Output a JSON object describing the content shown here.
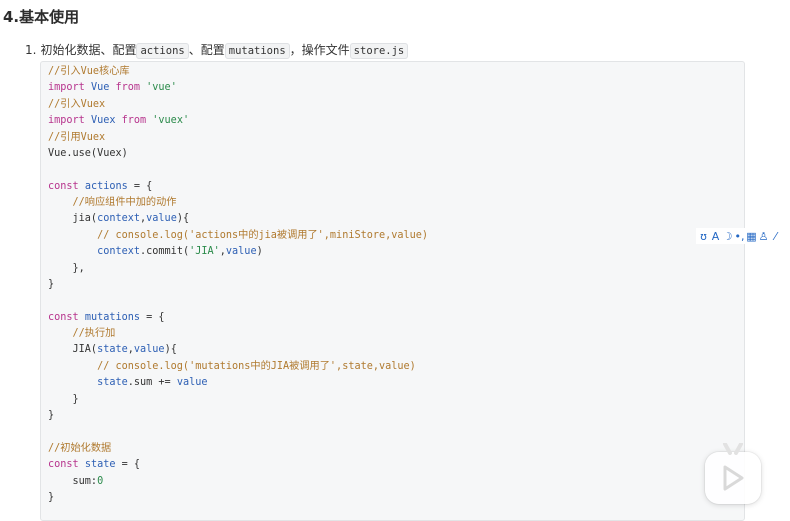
{
  "heading": "4.基本使用",
  "list_item": {
    "number": "1.",
    "text_1": "初始化数据、配置",
    "code_1": "actions",
    "text_2": "、配置",
    "code_2": "mutations",
    "text_3": "，操作文件",
    "code_3": "store.js"
  },
  "code_lines": [
    [
      {
        "t": "//引入Vue核心库",
        "c": "comment"
      }
    ],
    [
      {
        "t": "import ",
        "c": "keyword"
      },
      {
        "t": "Vue ",
        "c": "var"
      },
      {
        "t": "from ",
        "c": "keyword"
      },
      {
        "t": "'vue'",
        "c": "string"
      }
    ],
    [
      {
        "t": "//引入Vuex",
        "c": "comment"
      }
    ],
    [
      {
        "t": "import ",
        "c": "keyword"
      },
      {
        "t": "Vuex ",
        "c": "var"
      },
      {
        "t": "from ",
        "c": "keyword"
      },
      {
        "t": "'vuex'",
        "c": "string"
      }
    ],
    [
      {
        "t": "//引用Vuex",
        "c": "comment"
      }
    ],
    [
      {
        "t": "Vue.use(Vuex)",
        "c": "plain"
      }
    ],
    [],
    [
      {
        "t": "const ",
        "c": "keyword"
      },
      {
        "t": "actions",
        "c": "var"
      },
      {
        "t": " = {",
        "c": "plain"
      }
    ],
    [
      {
        "t": "    //响应组件中加的动作",
        "c": "comment"
      }
    ],
    [
      {
        "t": "    jia(",
        "c": "plain"
      },
      {
        "t": "context",
        "c": "var"
      },
      {
        "t": ",",
        "c": "plain"
      },
      {
        "t": "value",
        "c": "var"
      },
      {
        "t": "){",
        "c": "plain"
      }
    ],
    [
      {
        "t": "        // console.log('actions中的jia被调用了',miniStore,value)",
        "c": "comment"
      }
    ],
    [
      {
        "t": "        ",
        "c": "plain"
      },
      {
        "t": "context",
        "c": "var"
      },
      {
        "t": ".commit(",
        "c": "plain"
      },
      {
        "t": "'JIA'",
        "c": "string"
      },
      {
        "t": ",",
        "c": "plain"
      },
      {
        "t": "value",
        "c": "var"
      },
      {
        "t": ")",
        "c": "plain"
      }
    ],
    [
      {
        "t": "    },",
        "c": "plain"
      }
    ],
    [
      {
        "t": "}",
        "c": "plain"
      }
    ],
    [],
    [
      {
        "t": "const ",
        "c": "keyword"
      },
      {
        "t": "mutations",
        "c": "var"
      },
      {
        "t": " = {",
        "c": "plain"
      }
    ],
    [
      {
        "t": "    //执行加",
        "c": "comment"
      }
    ],
    [
      {
        "t": "    JIA(",
        "c": "plain"
      },
      {
        "t": "state",
        "c": "var"
      },
      {
        "t": ",",
        "c": "plain"
      },
      {
        "t": "value",
        "c": "var"
      },
      {
        "t": "){",
        "c": "plain"
      }
    ],
    [
      {
        "t": "        // console.log('mutations中的JIA被调用了',state,value)",
        "c": "comment"
      }
    ],
    [
      {
        "t": "        ",
        "c": "plain"
      },
      {
        "t": "state",
        "c": "var"
      },
      {
        "t": ".sum += ",
        "c": "plain"
      },
      {
        "t": "value",
        "c": "var"
      }
    ],
    [
      {
        "t": "    }",
        "c": "plain"
      }
    ],
    [
      {
        "t": "}",
        "c": "plain"
      }
    ],
    [],
    [
      {
        "t": "//初始化数据",
        "c": "comment"
      }
    ],
    [
      {
        "t": "const ",
        "c": "keyword"
      },
      {
        "t": "state",
        "c": "var"
      },
      {
        "t": " = {",
        "c": "plain"
      }
    ],
    [
      {
        "t": "    sum:",
        "c": "plain"
      },
      {
        "t": "0",
        "c": "string"
      }
    ],
    [
      {
        "t": "}",
        "c": "plain"
      }
    ]
  ],
  "ime_toolbar": {
    "buttons": [
      {
        "name": "ime-logo-icon",
        "glyph": "ʊ"
      },
      {
        "name": "chinese-english-toggle",
        "glyph": "A"
      },
      {
        "name": "halfwidth-moon-icon",
        "glyph": "☽"
      },
      {
        "name": "punctuation-icon",
        "glyph": "•,"
      },
      {
        "name": "keyboard-icon",
        "glyph": "▦"
      },
      {
        "name": "user-icon",
        "glyph": "♙"
      },
      {
        "name": "skin-icon",
        "glyph": "⁄"
      }
    ]
  },
  "colors": {
    "comment": "#b07a2f",
    "keyword": "#b7348d",
    "string": "#2a8a4a",
    "var": "#2d5fb4",
    "plain": "#333333"
  }
}
